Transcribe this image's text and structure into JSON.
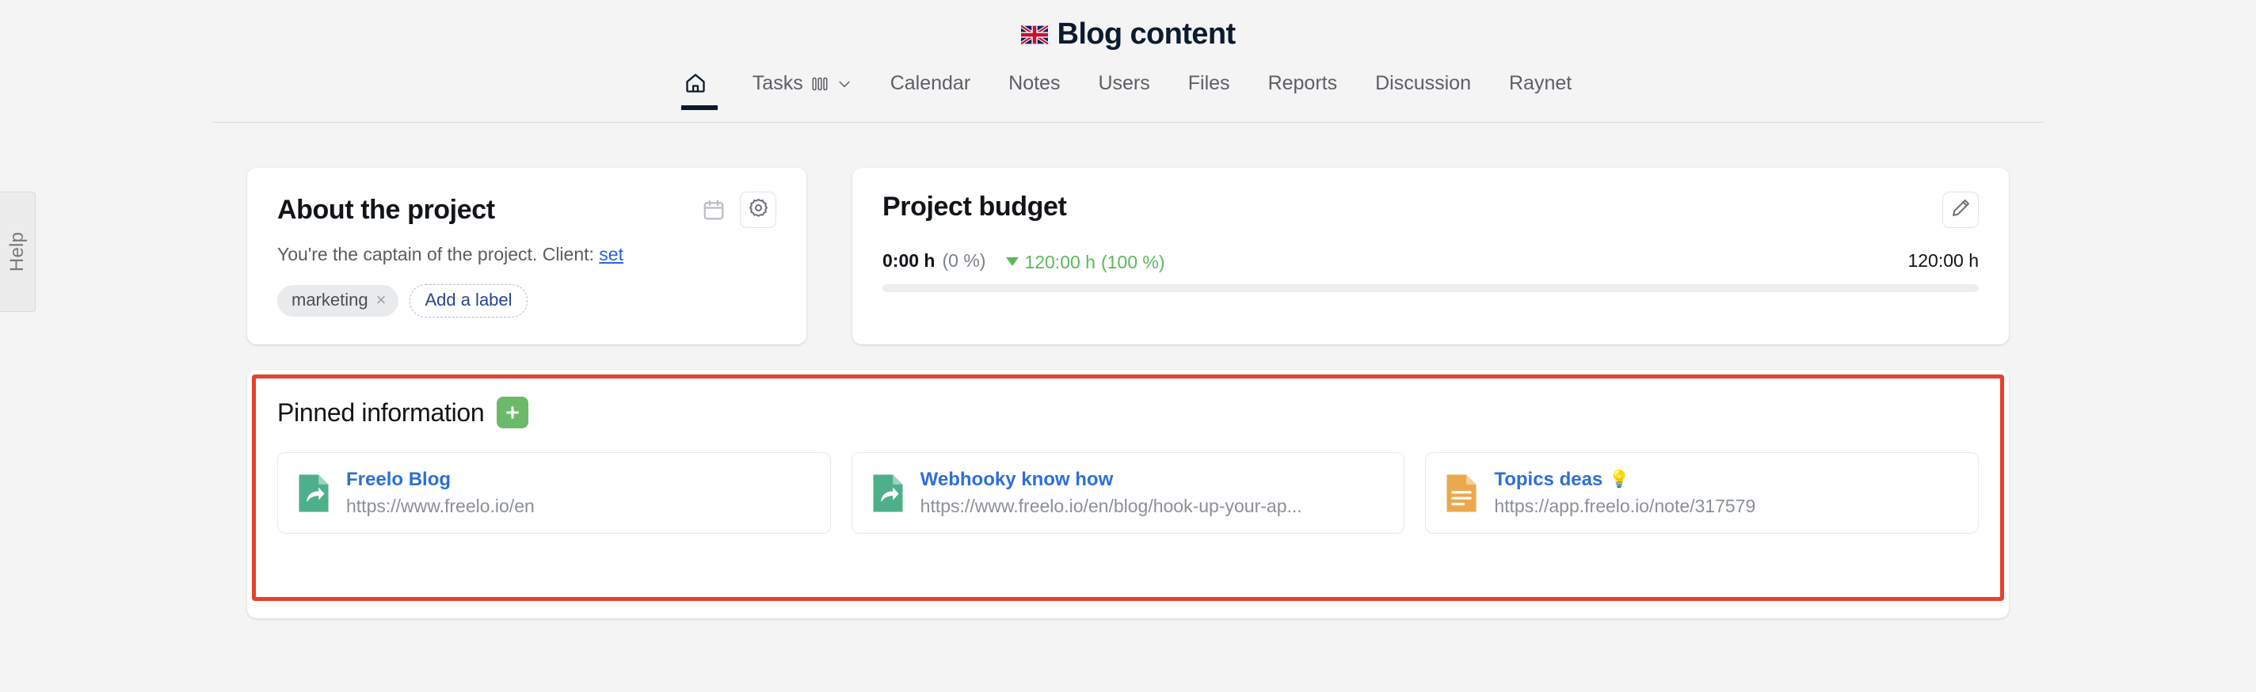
{
  "header": {
    "flag_icon": "uk-flag-icon",
    "title": "Blog content"
  },
  "nav": {
    "items": [
      {
        "label": "",
        "icon": "home-icon",
        "active": true
      },
      {
        "label": "Tasks",
        "icon": "kanban-icon",
        "trailing_icon": "chevron-down-icon",
        "active": false
      },
      {
        "label": "Calendar",
        "active": false
      },
      {
        "label": "Notes",
        "active": false
      },
      {
        "label": "Users",
        "active": false
      },
      {
        "label": "Files",
        "active": false
      },
      {
        "label": "Reports",
        "active": false
      },
      {
        "label": "Discussion",
        "active": false
      },
      {
        "label": "Raynet",
        "active": false
      }
    ]
  },
  "help_tab": {
    "label": "Help"
  },
  "about": {
    "title": "About the project",
    "calendar_icon": "calendar-icon",
    "settings_icon": "gear-icon",
    "description_prefix": "You're the captain of the project. Client: ",
    "client_link": "set",
    "labels": [
      {
        "text": "marketing",
        "remove": "×"
      }
    ],
    "add_label": "Add a label"
  },
  "budget": {
    "title": "Project budget",
    "edit_icon": "pencil-icon",
    "used": "0:00 h",
    "used_percent": "(0 %)",
    "remaining": "120:00 h",
    "remaining_percent": "(100 %)",
    "total": "120:00 h",
    "progress_percent": 0,
    "remaining_color": "#5cb85c",
    "track_color": "#eceef0"
  },
  "pinned": {
    "title": "Pinned information",
    "add_button_icon": "plus-icon",
    "highlight_color": "#e8402a",
    "items": [
      {
        "icon": "link-document-icon",
        "icon_color": "#4eb08a",
        "name": "Freelo Blog",
        "url": "https://www.freelo.io/en",
        "emoji": ""
      },
      {
        "icon": "link-document-icon",
        "icon_color": "#4eb08a",
        "name": "Webhooky know how",
        "url": "https://www.freelo.io/en/blog/hook-up-your-ap...",
        "emoji": ""
      },
      {
        "icon": "note-document-icon",
        "icon_color": "#eaa94e",
        "name": "Topics deas",
        "url": "https://app.freelo.io/note/317579",
        "emoji": "💡"
      }
    ]
  }
}
